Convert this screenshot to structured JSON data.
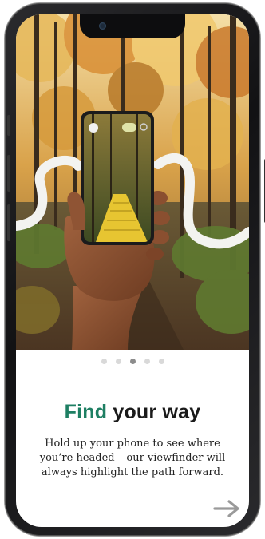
{
  "onboarding": {
    "headline_accent": "Find",
    "headline_rest": "your way",
    "body": "Hold up your phone to see where you’re headed – our viewfinder will always highlight the path forward.",
    "pager": {
      "count": 5,
      "active_index": 2
    },
    "next_icon": "arrow-right-icon"
  },
  "colors": {
    "accent": "#1e7f63",
    "dot_active": "#8c8c8c",
    "dot_inactive": "#d9d9d9"
  }
}
